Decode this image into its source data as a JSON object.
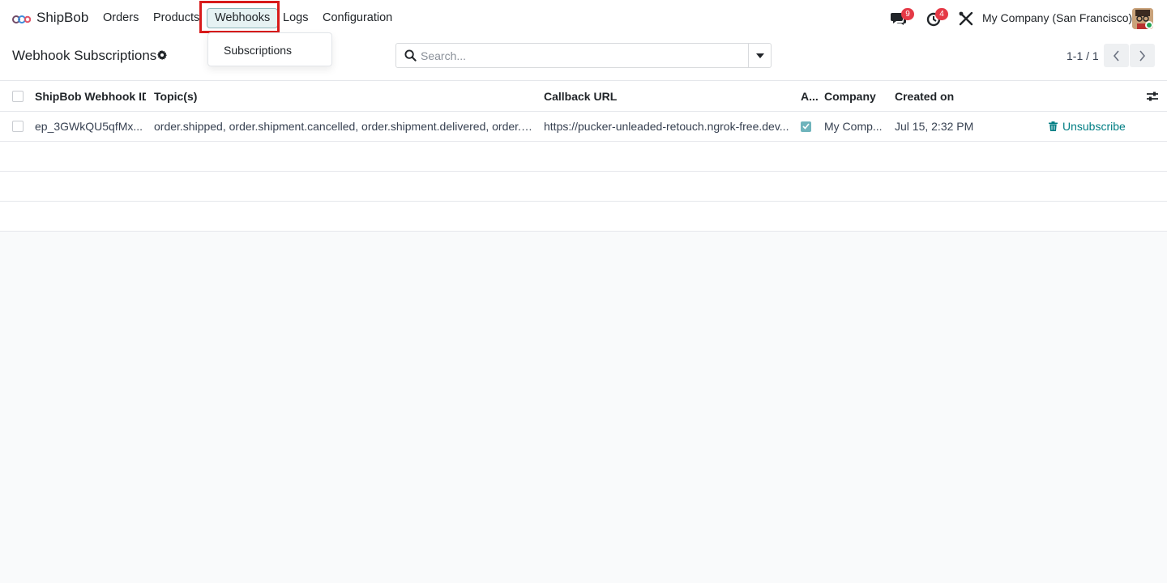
{
  "navbar": {
    "app_name": "ShipBob",
    "menu": {
      "orders": "Orders",
      "products": "Products",
      "webhooks": "Webhooks",
      "logs": "Logs",
      "configuration": "Configuration"
    },
    "messages_badge": "9",
    "activities_badge": "4",
    "company": "My Company (San Francisco)"
  },
  "dropdown": {
    "subscriptions": "Subscriptions"
  },
  "control_panel": {
    "title": "Webhook Subscriptions",
    "search_placeholder": "Search...",
    "pager": "1-1 / 1"
  },
  "table": {
    "columns": {
      "id": "ShipBob Webhook ID",
      "topics": "Topic(s)",
      "url": "Callback URL",
      "active": "A...",
      "company": "Company",
      "created": "Created on"
    },
    "rows": [
      {
        "id": "ep_3GWkQU5qfMx...",
        "topics": "order.shipped, order.shipment.cancelled, order.shipment.delivered, order.s...",
        "url": "https://pucker-unleaded-retouch.ngrok-free.dev...",
        "active": true,
        "company": "My Comp...",
        "created": "Jul 15, 2:32 PM",
        "action": "Unsubscribe"
      }
    ]
  },
  "colors": {
    "accent": "#017e84",
    "highlight": "#d81b1b",
    "badge": "#e53946"
  }
}
